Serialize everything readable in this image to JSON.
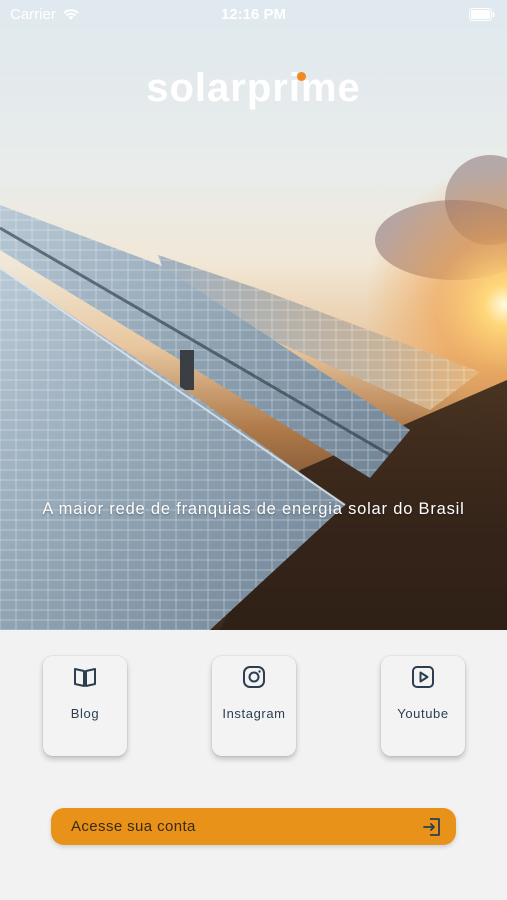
{
  "status_bar": {
    "carrier": "Carrier",
    "time": "12:16 PM"
  },
  "hero": {
    "logo_text": "solarprime",
    "tagline": "A maior rede de franquias de energia solar do Brasil"
  },
  "shortcuts": [
    {
      "label": "Blog",
      "icon": "book-icon"
    },
    {
      "label": "Instagram",
      "icon": "instagram-icon"
    },
    {
      "label": "Youtube",
      "icon": "youtube-icon"
    }
  ],
  "login_button": {
    "label": "Acesse sua conta",
    "icon": "login-icon"
  },
  "colors": {
    "accent": "#e89219",
    "logo_dot": "#f08a1c",
    "card_text": "#2c3e50"
  }
}
